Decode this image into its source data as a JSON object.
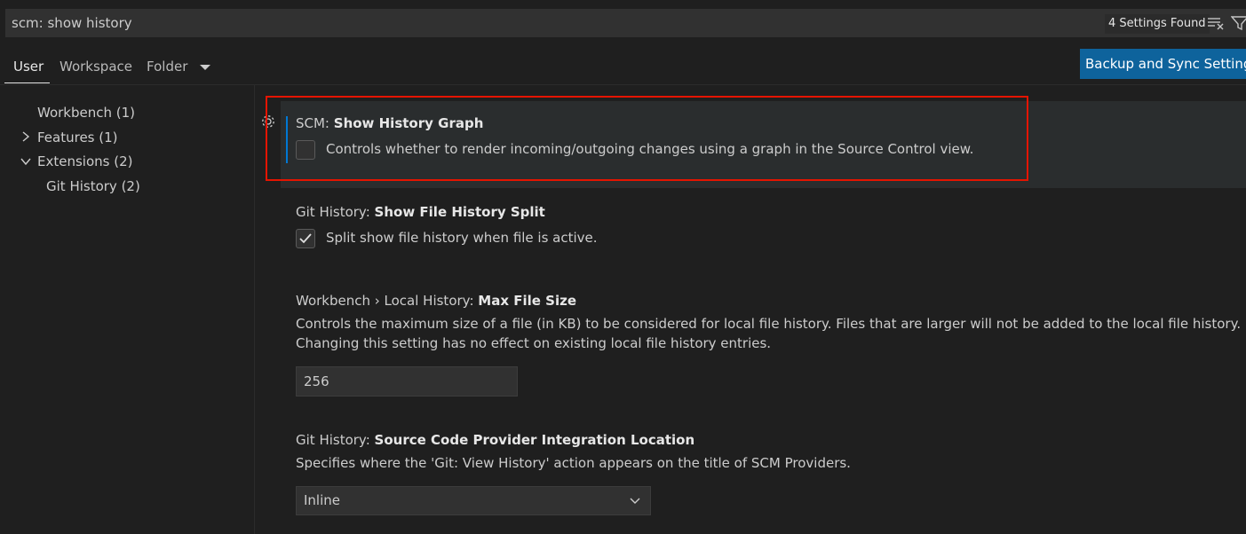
{
  "search": {
    "value": "scm: show history",
    "results_badge": "4 Settings Found"
  },
  "tabs": [
    {
      "label": "User",
      "active": true
    },
    {
      "label": "Workspace",
      "active": false
    },
    {
      "label": "Folder",
      "active": false
    }
  ],
  "sync_button": "Backup and Sync Settings",
  "tree": [
    {
      "label": "Workbench (1)",
      "expandable": false
    },
    {
      "label": "Features (1)",
      "expandable": true,
      "expanded": false
    },
    {
      "label": "Extensions (2)",
      "expandable": true,
      "expanded": true
    },
    {
      "label": "Git History (2)",
      "expandable": false
    }
  ],
  "settings": [
    {
      "category": "SCM: ",
      "name": "Show History Graph",
      "description": "Controls whether to render incoming/outgoing changes using a graph in the Source Control view.",
      "type": "checkbox",
      "checked": false
    },
    {
      "category": "Git History: ",
      "name": "Show File History Split",
      "description": "Split show file history when file is active.",
      "type": "checkbox",
      "checked": true
    },
    {
      "category": "Workbench › Local History: ",
      "name": "Max File Size",
      "description_line1": "Controls the maximum size of a file (in KB) to be considered for local file history. Files that are larger will not be added to the local file history.",
      "description_line2": "Changing this setting has no effect on existing local file history entries.",
      "type": "number",
      "value": "256"
    },
    {
      "category": "Git History: ",
      "name": "Source Code Provider Integration Location",
      "description": "Specifies where the 'Git: View History' action appears on the title of SCM Providers.",
      "type": "select",
      "value": "Inline"
    }
  ],
  "colors": {
    "accent": "#0078d4",
    "button": "#0e639c",
    "highlight_border": "#e51400"
  }
}
